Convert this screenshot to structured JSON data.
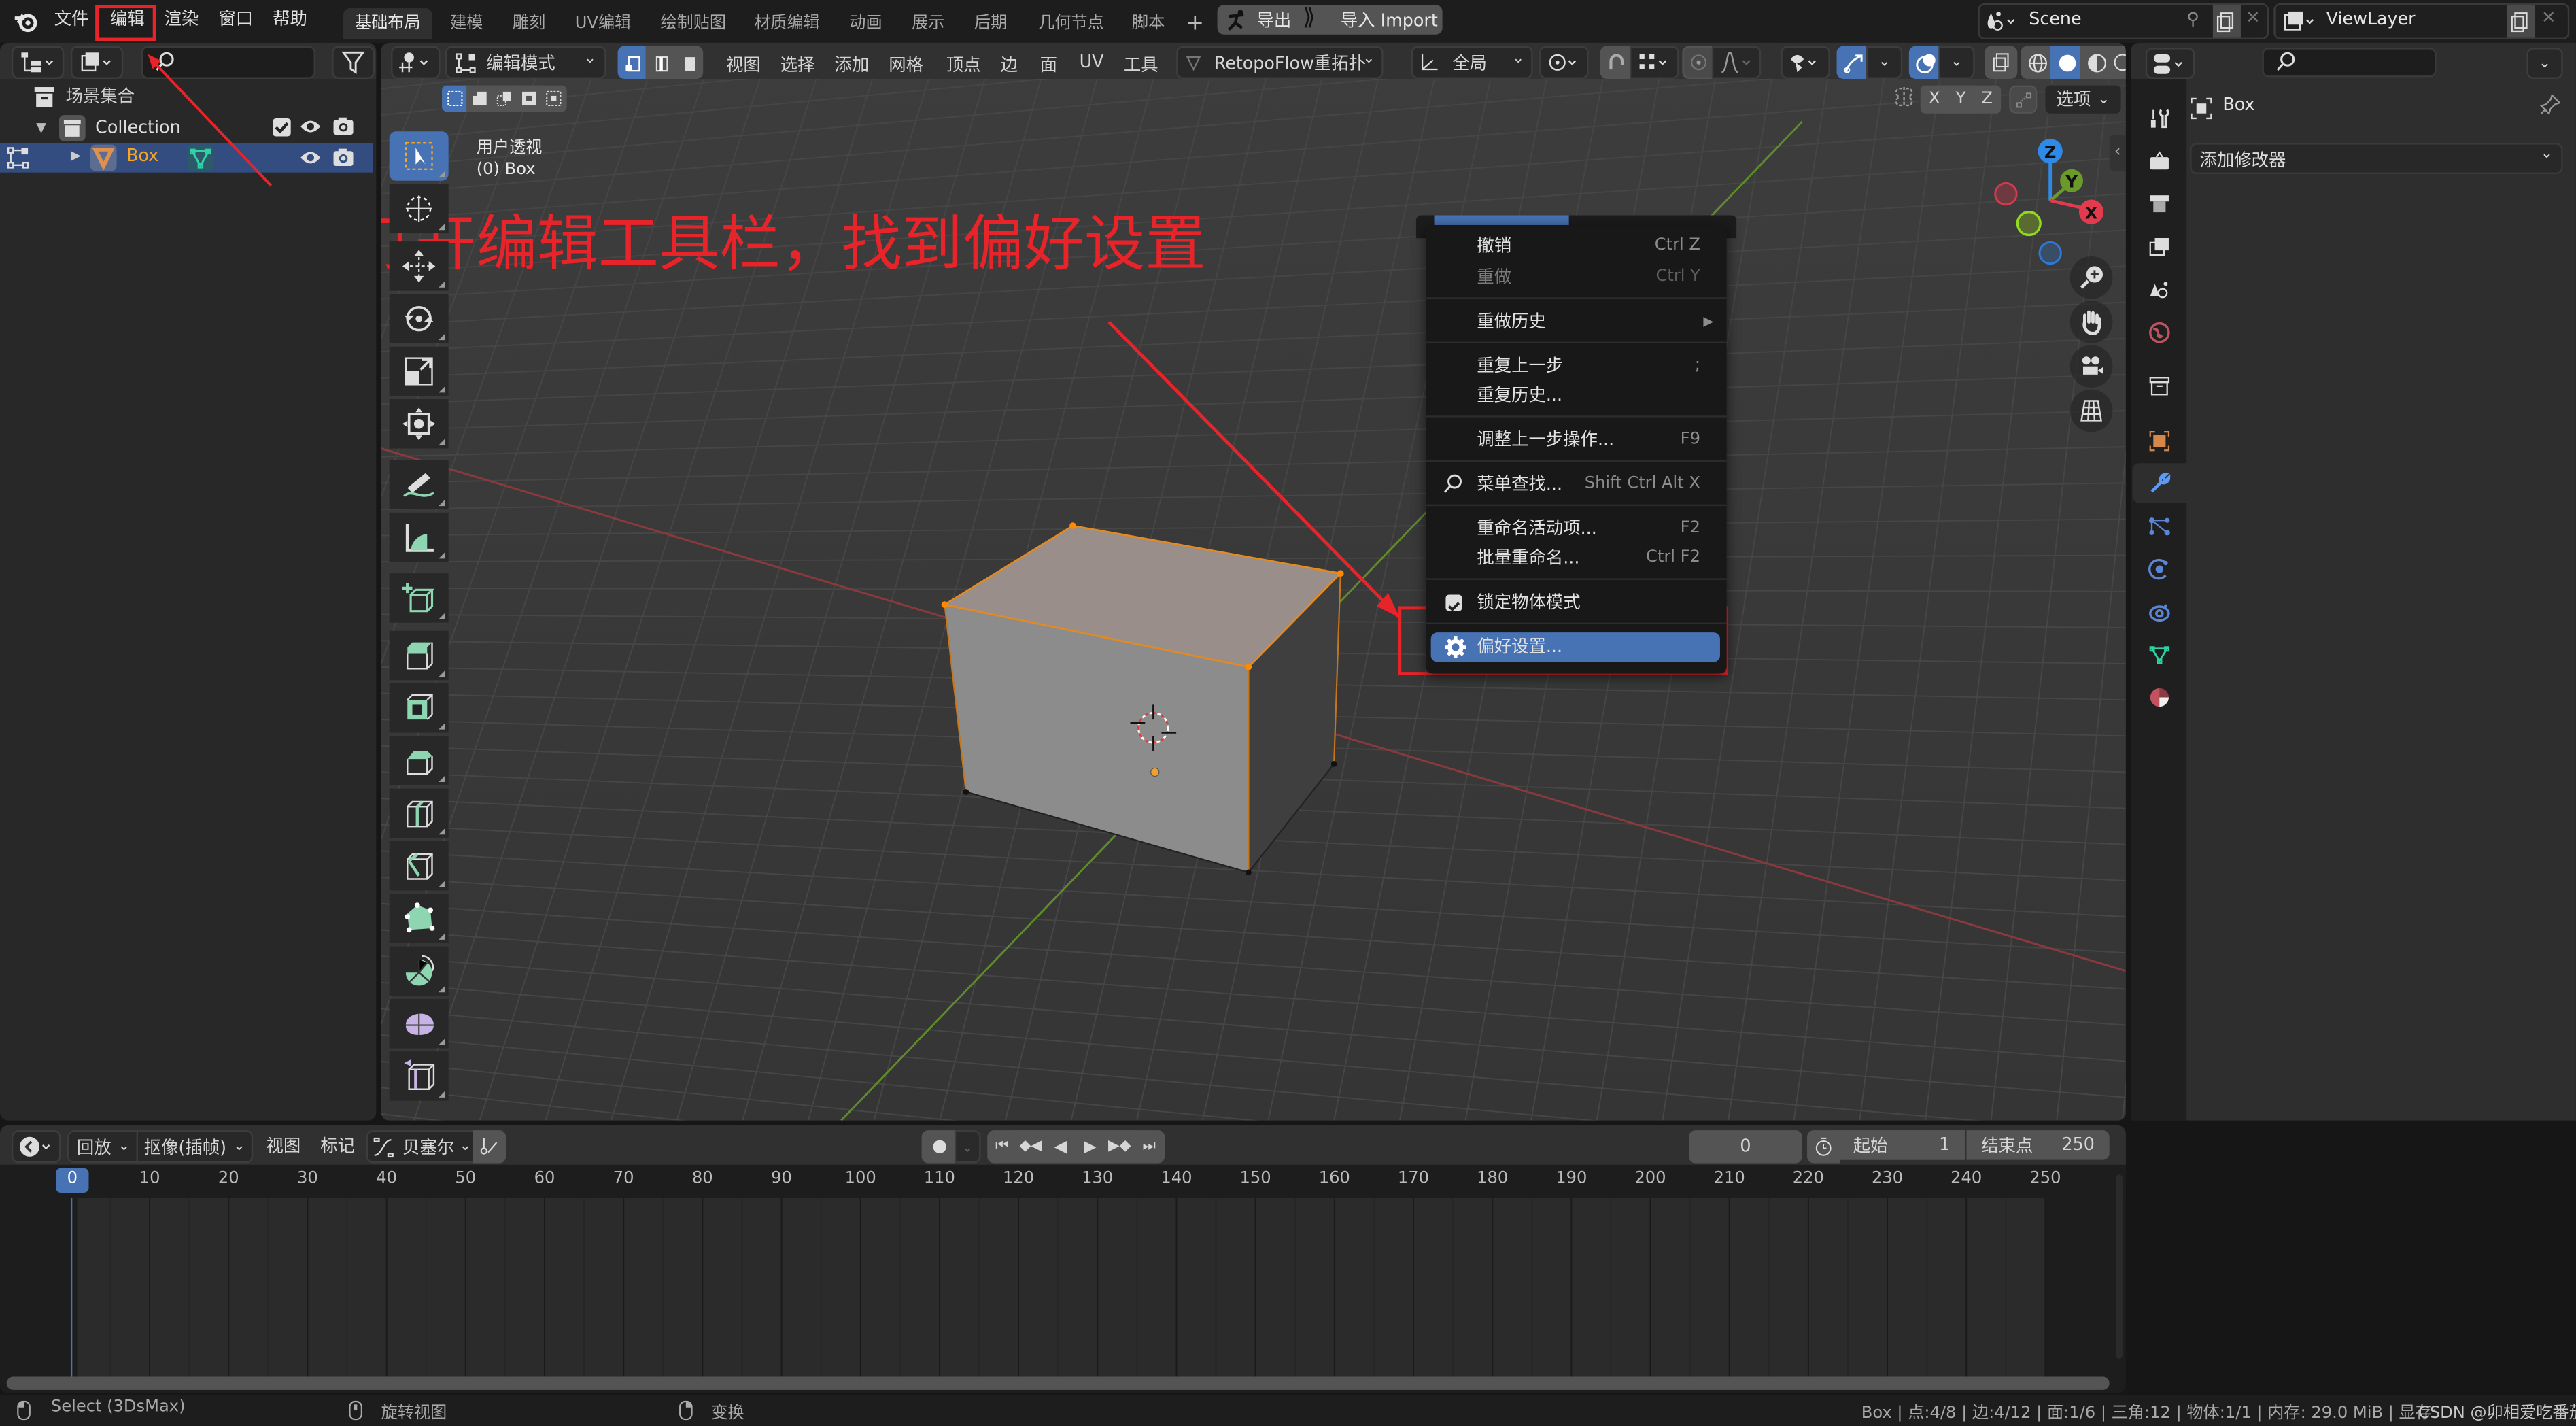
{
  "topbar": {
    "menus": [
      "文件",
      "编辑",
      "渲染",
      "窗口",
      "帮助"
    ],
    "highlighted_menu": "编辑",
    "workspaces": [
      "基础布局",
      "建模",
      "雕刻",
      "UV编辑",
      "绘制贴图",
      "材质编辑",
      "动画",
      "展示",
      "后期",
      "几何节点",
      "脚本"
    ],
    "active_workspace": "基础布局",
    "add_workspace": "+",
    "export_label": "导出",
    "import_label": "导入 Import",
    "scene_name": "Scene",
    "viewlayer_name": "ViewLayer"
  },
  "outliner": {
    "search_placeholder": "",
    "scene_collection": "场景集合",
    "collection": "Collection",
    "object": "Box"
  },
  "viewport_header": {
    "mode": "编辑模式",
    "menus": [
      "视图",
      "选择",
      "添加",
      "网格",
      "顶点",
      "边",
      "面",
      "UV",
      "工具"
    ],
    "addon": "RetopoFlow重拓扑",
    "transform_orientation": "全局",
    "axes": [
      "X",
      "Y",
      "Z"
    ],
    "options": "选项"
  },
  "viewport": {
    "view_name": "用户透视",
    "object_label": "(0) Box",
    "annotation": "打开编辑工具栏，找到偏好设置",
    "gizmo_axes": [
      "Z",
      "Y",
      "X"
    ]
  },
  "context_menu": {
    "items": [
      {
        "label": "撤销",
        "shortcut": "Ctrl Z",
        "disabled": false
      },
      {
        "label": "重做",
        "shortcut": "Ctrl Y",
        "disabled": true
      },
      {
        "label": "重做历史",
        "shortcut": "▶",
        "disabled": false
      },
      {
        "label": "重复上一步",
        "shortcut": ";",
        "disabled": false
      },
      {
        "label": "重复历史...",
        "shortcut": "",
        "disabled": false
      },
      {
        "label": "调整上一步操作...",
        "shortcut": "F9",
        "disabled": false
      },
      {
        "label": "菜单查找...",
        "shortcut": "Shift Ctrl Alt X",
        "disabled": false
      },
      {
        "label": "重命名活动项...",
        "shortcut": "F2",
        "disabled": false
      },
      {
        "label": "批量重命名...",
        "shortcut": "Ctrl F2",
        "disabled": false
      },
      {
        "label": "锁定物体模式",
        "shortcut": "",
        "checked": true
      },
      {
        "label": "偏好设置...",
        "shortcut": "",
        "active": true
      }
    ]
  },
  "properties": {
    "object_name": "Box",
    "add_modifier": "添加修改器"
  },
  "timeline": {
    "playback": "回放",
    "keying": "抠像(插帧)",
    "view": "视图",
    "marker": "标记",
    "interpolation": "贝塞尔",
    "current_frame": "0",
    "start_label": "起始",
    "start_value": "1",
    "end_label": "结束点",
    "end_value": "250",
    "ticks": [
      "0",
      "10",
      "20",
      "30",
      "40",
      "50",
      "60",
      "70",
      "80",
      "90",
      "100",
      "110",
      "120",
      "130",
      "140",
      "150",
      "160",
      "170",
      "180",
      "190",
      "200",
      "210",
      "220",
      "230",
      "240",
      "250"
    ]
  },
  "statusbar": {
    "left_mouse": "Select (3DsMax)",
    "middle_mouse": "旋转视图",
    "right_mouse": "变换",
    "stats": "Box | 点:4/8 | 边:4/12 | 面:1/6 | 三角:12 | 物体:1/1 | 内存: 29.0 MiB | 显存:",
    "watermark": "CSDN @卯相爱吃番茄酱"
  },
  "colors": {
    "accent": "#4772b3",
    "annotation_red": "#e8242b",
    "selected_orange": "#f5a623"
  }
}
